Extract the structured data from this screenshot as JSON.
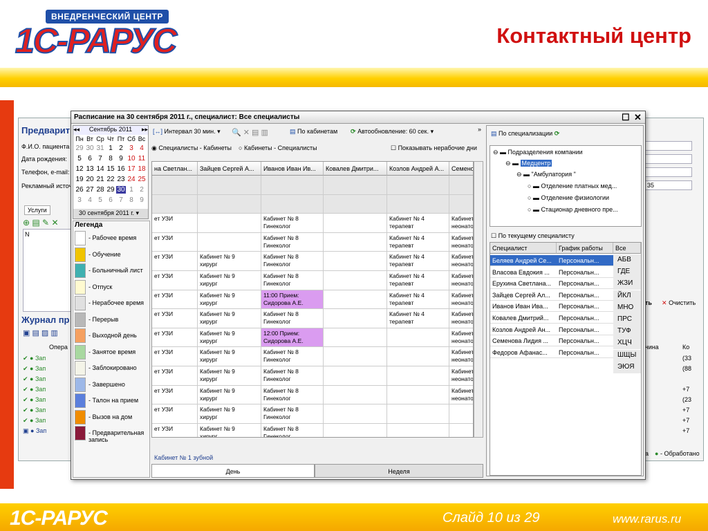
{
  "header": {
    "badge": "ВНЕДРЕНЧЕСКИЙ ЦЕНТР",
    "logo": "1С-РАРУС",
    "title": "Контактный центр"
  },
  "footer": {
    "logo": "1С-РАРУС",
    "slide": "Слайд 10 из 29",
    "url": "www.rarus.ru"
  },
  "background": {
    "section1": "Предварит",
    "fio": "Ф.И.О. пациента",
    "dob": "Дата рождения:",
    "phone": "Телефон, e-mail:",
    "ad": "Рекламный источ",
    "num": "35",
    "services_tab": "Услуги",
    "col_n": "N",
    "section2": "Журнал пр",
    "ops": "Опера",
    "call": "Зап",
    "btn_save": "ть",
    "btn_clear": "Очистить",
    "col_reason": "чина",
    "col_ko": "Ко",
    "r_values": [
      "(33",
      "(88",
      "",
      "+7",
      "(23",
      "+7",
      "+7",
      "+7"
    ],
    "status_a": "а",
    "status_b": "- Обработано"
  },
  "dialog": {
    "title": "Расписание на 30 сентября 2011 г., специалист: Все специалисты",
    "calendar": {
      "month": "Сентябрь 2011",
      "weekdays": [
        "Пн",
        "Вт",
        "Ср",
        "Чт",
        "Пт",
        "Сб",
        "Вс"
      ],
      "rows": [
        [
          "29",
          "30",
          "31",
          "1",
          "2",
          "3",
          "4"
        ],
        [
          "5",
          "6",
          "7",
          "8",
          "9",
          "10",
          "11"
        ],
        [
          "12",
          "13",
          "14",
          "15",
          "16",
          "17",
          "18"
        ],
        [
          "19",
          "20",
          "21",
          "22",
          "23",
          "24",
          "25"
        ],
        [
          "26",
          "27",
          "28",
          "29",
          "30",
          "1",
          "2"
        ],
        [
          "3",
          "4",
          "5",
          "6",
          "7",
          "8",
          "9"
        ]
      ],
      "selected": "30 сентября 2011 г."
    },
    "legend": {
      "title": "Легенда",
      "items": [
        {
          "label": "- Рабочее время",
          "color": "#ffffff"
        },
        {
          "label": "- Обучение",
          "color": "#f0c400"
        },
        {
          "label": "- Больничный лист",
          "color": "#3fb0b0"
        },
        {
          "label": "- Отпуск",
          "color": "#fffad0"
        },
        {
          "label": "- Нерабочее время",
          "color": "#e0e0e0"
        },
        {
          "label": "- Перерыв",
          "color": "#b8b8b8"
        },
        {
          "label": "- Выходной день",
          "color": "#f5a060"
        },
        {
          "label": "- Занятое время",
          "color": "#a8d8a0"
        },
        {
          "label": "- Заблокировано",
          "color": "#f4f4e8"
        },
        {
          "label": "- Завершено",
          "color": "#9db8e8"
        },
        {
          "label": "- Талон на прием",
          "color": "#5b7fdc"
        },
        {
          "label": "- Вызов на дом",
          "color": "#f08c00"
        },
        {
          "label": "- Предварительная запись",
          "color": "#8a1a3a"
        }
      ]
    },
    "toolbar": {
      "interval": "Интервал 30 мин.",
      "by_cab": "По кабинетам",
      "auto": "Автообновление: 60 сек.",
      "more": "»"
    },
    "view": {
      "opt1": "Специалисты - Кабинеты",
      "opt2": "Кабинеты - Специалисты",
      "nonwork": "Показывать нерабочие дни"
    },
    "grid": {
      "columns": [
        "на Светлан...",
        "Зайцев Сергей А...",
        "Иванов Иван Ив...",
        "Ковалев Дмитри...",
        "Козлов Андрей А...",
        "Семено"
      ],
      "rows": [
        {
          "g": true,
          "cells": [
            "",
            "",
            "",
            "",
            "",
            ""
          ]
        },
        {
          "g": true,
          "cells": [
            "",
            "",
            "",
            "",
            "",
            ""
          ]
        },
        {
          "cells": [
            "ет УЗИ",
            "",
            "Кабинет № 8\nГинеколог",
            "",
            "Кабинет № 4\nтерапевт",
            "Кабинет\nнеонато"
          ]
        },
        {
          "cells": [
            "ет УЗИ",
            "",
            "Кабинет № 8\nГинеколог",
            "",
            "Кабинет № 4\nтерапевт",
            "Кабинет\nнеонато"
          ]
        },
        {
          "cells": [
            "ет УЗИ",
            "Кабинет № 9\nхирург",
            "Кабинет № 8\nГинеколог",
            "",
            "Кабинет № 4\nтерапевт",
            "Кабинет\nнеонато"
          ]
        },
        {
          "cells": [
            "ет УЗИ",
            "Кабинет № 9\nхирург",
            "Кабинет № 8\nГинеколог",
            "",
            "Кабинет № 4\nтерапевт",
            "Кабинет\nнеонато"
          ]
        },
        {
          "p": 2,
          "cells": [
            "ет УЗИ",
            "Кабинет № 9\nхирург",
            "11:00 Прием:\nСидорова А.Е.",
            "",
            "Кабинет № 4\nтерапевт",
            "Кабинет\nнеонато"
          ]
        },
        {
          "cells": [
            "ет УЗИ",
            "Кабинет № 9\nхирург",
            "Кабинет № 8\nГинеколог",
            "",
            "Кабинет № 4\nтерапевт",
            "Кабинет\nнеонато"
          ]
        },
        {
          "p": 2,
          "cells": [
            "ет УЗИ",
            "Кабинет № 9\nхирург",
            "12:00 Прием:\nСидорова А.Е.",
            "",
            "",
            "Кабинет\nнеонато"
          ]
        },
        {
          "cells": [
            "ет УЗИ",
            "Кабинет № 9\nхирург",
            "Кабинет № 8\nГинеколог",
            "",
            "",
            "Кабинет\nнеонато"
          ]
        },
        {
          "cells": [
            "ет УЗИ",
            "Кабинет № 9\nхирург",
            "Кабинет № 8\nГинеколог",
            "",
            "",
            "Кабинет\nнеонато"
          ]
        },
        {
          "cells": [
            "ет УЗИ",
            "Кабинет № 9\nхирург",
            "Кабинет № 8\nГинеколог",
            "",
            "",
            "Кабинет\nнеонато"
          ]
        },
        {
          "cells": [
            "ет УЗИ",
            "Кабинет № 9\nхирург",
            "Кабинет № 8\nГинеколог",
            "",
            "",
            ""
          ]
        },
        {
          "cells": [
            "ет УЗИ",
            "Кабинет № 9\nхирург",
            "Кабинет № 8\nГинеколог",
            "",
            "",
            ""
          ]
        },
        {
          "cells": [
            "",
            "",
            "",
            "",
            "",
            ""
          ]
        }
      ]
    },
    "status": "Кабинет № 1 зубной",
    "tabs": [
      "День",
      "Неделя"
    ],
    "right": {
      "by_spec": "По специализации",
      "tree": [
        "Подразделения компании",
        "Медцентр",
        "\"Амбулатория \"",
        "Отделение платных мед...",
        "Отделение физиологии",
        "Стационар дневного пре..."
      ],
      "cur_spec": "По текущему специалисту",
      "cols": [
        "Специалист",
        "График работы",
        "Все"
      ],
      "specialists": [
        [
          "Беляев Андрей Се...",
          "Персональн..."
        ],
        [
          "Власова Евдокия ...",
          "Персональн..."
        ],
        [
          "Ерухина Светлана...",
          "Персональн..."
        ],
        [
          "Зайцев Сергей Ал...",
          "Персональн..."
        ],
        [
          "Иванов Иван Ива...",
          "Персональн..."
        ],
        [
          "Ковалев Дмитрий...",
          "Персональн..."
        ],
        [
          "Козлов Андрей Ан...",
          "Персональн..."
        ],
        [
          "Семенова Лидия ...",
          "Персональн..."
        ],
        [
          "Федоров Афанас...",
          "Персональн..."
        ]
      ],
      "alpha": [
        "АБВ",
        "ГДЕ",
        "ЖЗИ",
        "ЙКЛ",
        "МНО",
        "ПРС",
        "ТУФ",
        "ХЦЧ",
        "ШЩЫ",
        "ЭЮЯ"
      ]
    }
  }
}
